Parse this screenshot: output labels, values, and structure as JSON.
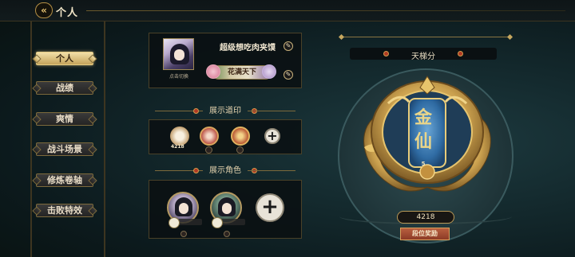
{
  "header": {
    "back_glyph": "«",
    "title": "个人"
  },
  "sidebar": {
    "items": [
      {
        "label": "个人",
        "active": true
      },
      {
        "label": "战绩",
        "active": false
      },
      {
        "label": "爽情",
        "active": false
      },
      {
        "label": "战斗场景",
        "active": false
      },
      {
        "label": "修炼卷轴",
        "active": false
      },
      {
        "label": "击败特效",
        "active": false
      }
    ]
  },
  "profile": {
    "name": "超级想吃肉夹馍",
    "avatar_caption": "点击切换",
    "title_badge": "花满天下",
    "edit_glyph": "✎"
  },
  "emblems": {
    "section_title": "展示道印",
    "count_label": "4218",
    "add_glyph": "+"
  },
  "roles": {
    "section_title": "展示角色",
    "add_glyph": "+"
  },
  "rank": {
    "section_title": "天梯分",
    "rank_chars": [
      "金",
      "仙"
    ],
    "rank_level": "5",
    "score": "4218",
    "button_label": "段位奖励"
  },
  "colors": {
    "gold": "#c9a45c",
    "active_tab": "#e9d59b",
    "accent_red": "#b03a24",
    "background": "#0c1a1d"
  }
}
